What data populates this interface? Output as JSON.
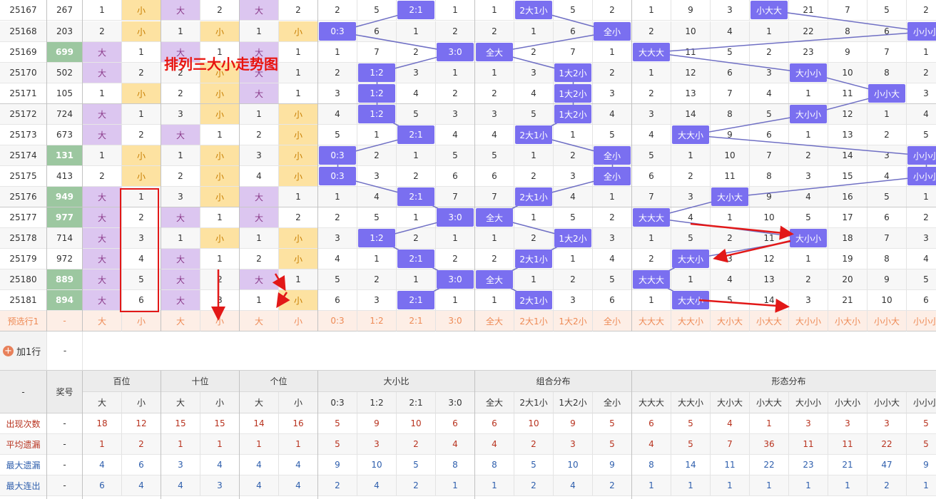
{
  "title": "排列三大小走势图",
  "add_row": "加1行",
  "add_row_val": "-",
  "summary_dash": "-",
  "colors": {
    "purple": "#dcc6f0",
    "yellow": "#fde2a1",
    "green": "#9cc7a0",
    "blue_ball": "#7a6ff0",
    "line": "#6f6fc4",
    "red": "#e21818",
    "preselect_bg": "#fdeee6",
    "preselect_text": "#ee8a55"
  },
  "columns": [
    "大小比:0:3",
    "大小比:1:2",
    "大小比:2:1",
    "大小比:3:0",
    "组合:全大",
    "组合:2大1小",
    "组合:1大2小",
    "组合:全小",
    "形态:大大大",
    "形态:大大小",
    "形态:大小大",
    "形态:小大大",
    "形态:大小小",
    "形态:小大小",
    "形态:小小大",
    "形态:小小小"
  ],
  "rows": [
    {
      "issue": "25167",
      "num": "267",
      "bai": [
        "1",
        "小"
      ],
      "shi": [
        "大",
        "2"
      ],
      "ge": [
        "大",
        "2"
      ],
      "ratio": [
        "2",
        "5",
        "2:1",
        "1"
      ],
      "combo": [
        "1",
        "2大1小",
        "5",
        "2"
      ],
      "form": [
        "1",
        "9",
        "3",
        "小大大",
        "21",
        "7",
        "5",
        "2"
      ],
      "ri": 2,
      "ci": 1,
      "fi": 3,
      "hl": false
    },
    {
      "issue": "25168",
      "num": "203",
      "bai": [
        "2",
        "小"
      ],
      "shi": [
        "1",
        "小"
      ],
      "ge": [
        "1",
        "小"
      ],
      "ratio": [
        "0:3",
        "6",
        "1",
        "2"
      ],
      "combo": [
        "2",
        "1",
        "6",
        "全小"
      ],
      "form": [
        "2",
        "10",
        "4",
        "1",
        "22",
        "8",
        "6",
        "小小小"
      ],
      "ri": 0,
      "ci": 3,
      "fi": 7,
      "hl": false
    },
    {
      "issue": "25169",
      "num": "699",
      "bai": [
        "大",
        "1"
      ],
      "shi": [
        "大",
        "1"
      ],
      "ge": [
        "大",
        "1"
      ],
      "ratio": [
        "1",
        "7",
        "2",
        "3:0"
      ],
      "combo": [
        "全大",
        "2",
        "7",
        "1"
      ],
      "form": [
        "大大大",
        "11",
        "5",
        "2",
        "23",
        "9",
        "7",
        "1"
      ],
      "ri": 3,
      "ci": 0,
      "fi": 0,
      "hl": true
    },
    {
      "issue": "25170",
      "num": "502",
      "bai": [
        "大",
        "2"
      ],
      "shi": [
        "2",
        "小"
      ],
      "ge": [
        "大",
        "1"
      ],
      "ratio": [
        "2",
        "1:2",
        "3",
        "1"
      ],
      "combo": [
        "1",
        "3",
        "1大2小",
        "2"
      ],
      "form": [
        "1",
        "12",
        "6",
        "3",
        "大小小",
        "10",
        "8",
        "2"
      ],
      "ri": 1,
      "ci": 2,
      "fi": 4,
      "hl": false
    },
    {
      "issue": "25171",
      "num": "105",
      "bai": [
        "1",
        "小"
      ],
      "shi": [
        "2",
        "小"
      ],
      "ge": [
        "大",
        "1"
      ],
      "ratio": [
        "3",
        "1:2",
        "4",
        "2"
      ],
      "combo": [
        "2",
        "4",
        "1大2小",
        "3"
      ],
      "form": [
        "2",
        "13",
        "7",
        "4",
        "1",
        "11",
        "小小大",
        "3"
      ],
      "ri": 1,
      "ci": 2,
      "fi": 6,
      "hl": false
    },
    {
      "issue": "25172",
      "num": "724",
      "bai": [
        "大",
        "1"
      ],
      "shi": [
        "3",
        "小"
      ],
      "ge": [
        "1",
        "小"
      ],
      "ratio": [
        "4",
        "1:2",
        "5",
        "3"
      ],
      "combo": [
        "3",
        "5",
        "1大2小",
        "4"
      ],
      "form": [
        "3",
        "14",
        "8",
        "5",
        "大小小",
        "12",
        "1",
        "4"
      ],
      "ri": 1,
      "ci": 2,
      "fi": 4,
      "hl": false
    },
    {
      "issue": "25173",
      "num": "673",
      "bai": [
        "大",
        "2"
      ],
      "shi": [
        "大",
        "1"
      ],
      "ge": [
        "2",
        "小"
      ],
      "ratio": [
        "5",
        "1",
        "2:1",
        "4"
      ],
      "combo": [
        "4",
        "2大1小",
        "1",
        "5"
      ],
      "form": [
        "4",
        "大大小",
        "9",
        "6",
        "1",
        "13",
        "2",
        "5"
      ],
      "ri": 2,
      "ci": 1,
      "fi": 1,
      "hl": false
    },
    {
      "issue": "25174",
      "num": "131",
      "bai": [
        "1",
        "小"
      ],
      "shi": [
        "1",
        "小"
      ],
      "ge": [
        "3",
        "小"
      ],
      "ratio": [
        "0:3",
        "2",
        "1",
        "5"
      ],
      "combo": [
        "5",
        "1",
        "2",
        "全小"
      ],
      "form": [
        "5",
        "1",
        "10",
        "7",
        "2",
        "14",
        "3",
        "小小小"
      ],
      "ri": 0,
      "ci": 3,
      "fi": 7,
      "hl": true
    },
    {
      "issue": "25175",
      "num": "413",
      "bai": [
        "2",
        "小"
      ],
      "shi": [
        "2",
        "小"
      ],
      "ge": [
        "4",
        "小"
      ],
      "ratio": [
        "0:3",
        "3",
        "2",
        "6"
      ],
      "combo": [
        "6",
        "2",
        "3",
        "全小"
      ],
      "form": [
        "6",
        "2",
        "11",
        "8",
        "3",
        "15",
        "4",
        "小小小"
      ],
      "ri": 0,
      "ci": 3,
      "fi": 7,
      "hl": false
    },
    {
      "issue": "25176",
      "num": "949",
      "bai": [
        "大",
        "1"
      ],
      "shi": [
        "3",
        "小"
      ],
      "ge": [
        "大",
        "1"
      ],
      "ratio": [
        "1",
        "4",
        "2:1",
        "7"
      ],
      "combo": [
        "7",
        "2大1小",
        "4",
        "1"
      ],
      "form": [
        "7",
        "3",
        "大小大",
        "9",
        "4",
        "16",
        "5",
        "1"
      ],
      "ri": 2,
      "ci": 1,
      "fi": 2,
      "hl": true
    },
    {
      "issue": "25177",
      "num": "977",
      "bai": [
        "大",
        "2"
      ],
      "shi": [
        "大",
        "1"
      ],
      "ge": [
        "大",
        "2"
      ],
      "ratio": [
        "2",
        "5",
        "1",
        "3:0"
      ],
      "combo": [
        "全大",
        "1",
        "5",
        "2"
      ],
      "form": [
        "大大大",
        "4",
        "1",
        "10",
        "5",
        "17",
        "6",
        "2"
      ],
      "ri": 3,
      "ci": 0,
      "fi": 0,
      "hl": true
    },
    {
      "issue": "25178",
      "num": "714",
      "bai": [
        "大",
        "3"
      ],
      "shi": [
        "1",
        "小"
      ],
      "ge": [
        "1",
        "小"
      ],
      "ratio": [
        "3",
        "1:2",
        "2",
        "1"
      ],
      "combo": [
        "1",
        "2",
        "1大2小",
        "3"
      ],
      "form": [
        "1",
        "5",
        "2",
        "11",
        "大小小",
        "18",
        "7",
        "3"
      ],
      "ri": 1,
      "ci": 2,
      "fi": 4,
      "hl": false
    },
    {
      "issue": "25179",
      "num": "972",
      "bai": [
        "大",
        "4"
      ],
      "shi": [
        "大",
        "1"
      ],
      "ge": [
        "2",
        "小"
      ],
      "ratio": [
        "4",
        "1",
        "2:1",
        "2"
      ],
      "combo": [
        "2",
        "2大1小",
        "1",
        "4"
      ],
      "form": [
        "2",
        "大大小",
        "3",
        "12",
        "1",
        "19",
        "8",
        "4"
      ],
      "ri": 2,
      "ci": 1,
      "fi": 1,
      "hl": false
    },
    {
      "issue": "25180",
      "num": "889",
      "bai": [
        "大",
        "5"
      ],
      "shi": [
        "大",
        "2"
      ],
      "ge": [
        "大",
        "1"
      ],
      "ratio": [
        "5",
        "2",
        "1",
        "3:0"
      ],
      "combo": [
        "全大",
        "1",
        "2",
        "5"
      ],
      "form": [
        "大大大",
        "1",
        "4",
        "13",
        "2",
        "20",
        "9",
        "5"
      ],
      "ri": 3,
      "ci": 0,
      "fi": 0,
      "hl": true
    },
    {
      "issue": "25181",
      "num": "894",
      "bai": [
        "大",
        "6"
      ],
      "shi": [
        "大",
        "3"
      ],
      "ge": [
        "1",
        "小"
      ],
      "ratio": [
        "6",
        "3",
        "2:1",
        "1"
      ],
      "combo": [
        "1",
        "2大1小",
        "3",
        "6"
      ],
      "form": [
        "1",
        "大大小",
        "5",
        "14",
        "3",
        "21",
        "10",
        "6"
      ],
      "ri": 2,
      "ci": 1,
      "fi": 1,
      "hl": true
    }
  ],
  "preselect": {
    "label": "预选行1",
    "num": "-",
    "cells": [
      "大",
      "小",
      "大",
      "小",
      "大",
      "小",
      "0:3",
      "1:2",
      "2:1",
      "3:0",
      "全大",
      "2大1小",
      "1大2小",
      "全小",
      "大大大",
      "大大小",
      "大小大",
      "小大大",
      "大小小",
      "小大小",
      "小小大",
      "小小小"
    ]
  },
  "header": {
    "dash": "-",
    "prize": "奖号",
    "groups": [
      {
        "label": "百位",
        "span": 2
      },
      {
        "label": "十位",
        "span": 2
      },
      {
        "label": "个位",
        "span": 2
      },
      {
        "label": "大小比",
        "span": 4
      },
      {
        "label": "组合分布",
        "span": 4
      },
      {
        "label": "形态分布",
        "span": 8
      }
    ],
    "subs": [
      "大",
      "小",
      "大",
      "小",
      "大",
      "小",
      "0:3",
      "1:2",
      "2:1",
      "3:0",
      "全大",
      "2大1小",
      "1大2小",
      "全小",
      "大大大",
      "大大小",
      "大小大",
      "小大大",
      "大小小",
      "小大小",
      "小小大",
      "小小小"
    ]
  },
  "stats": [
    {
      "label": "出现次数",
      "num": "-",
      "color": "#b8331f",
      "vals": [
        "18",
        "12",
        "15",
        "15",
        "14",
        "16",
        "5",
        "9",
        "10",
        "6",
        "6",
        "10",
        "9",
        "5",
        "6",
        "5",
        "4",
        "1",
        "3",
        "3",
        "3",
        "5"
      ]
    },
    {
      "label": "平均遗漏",
      "num": "-",
      "color": "#b8331f",
      "vals": [
        "1",
        "2",
        "1",
        "1",
        "1",
        "1",
        "5",
        "3",
        "2",
        "4",
        "4",
        "2",
        "3",
        "5",
        "4",
        "5",
        "7",
        "36",
        "11",
        "11",
        "22",
        "5"
      ]
    },
    {
      "label": "最大遗漏",
      "num": "-",
      "color": "#2f5fad",
      "vals": [
        "4",
        "6",
        "3",
        "4",
        "4",
        "4",
        "9",
        "10",
        "5",
        "8",
        "8",
        "5",
        "10",
        "9",
        "8",
        "14",
        "11",
        "22",
        "23",
        "21",
        "47",
        "9"
      ]
    },
    {
      "label": "最大连出",
      "num": "-",
      "color": "#2f5fad",
      "vals": [
        "6",
        "4",
        "4",
        "3",
        "4",
        "4",
        "2",
        "4",
        "2",
        "1",
        "1",
        "2",
        "4",
        "2",
        "1",
        "1",
        "1",
        "1",
        "1",
        "1",
        "2",
        "1"
      ]
    }
  ]
}
